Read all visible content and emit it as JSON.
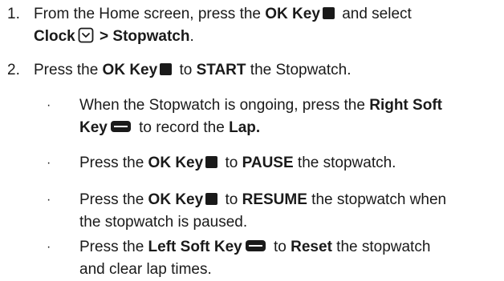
{
  "steps": [
    {
      "number": "1.",
      "line1": {
        "pre": "From the Home screen, press the ",
        "key": "OK Key",
        "post": " and select"
      },
      "line2": {
        "app": "Clock",
        "sep": " > ",
        "target": "Stopwatch",
        "end": "."
      }
    },
    {
      "number": "2.",
      "line1": {
        "pre": "Press the ",
        "key": "OK Key",
        "mid": " to ",
        "action": "START",
        "post": " the Stopwatch."
      }
    }
  ],
  "bullets": [
    {
      "symbol": "·",
      "line1": {
        "pre": "When the Stopwatch is ongoing, press the ",
        "key": "Right Soft"
      },
      "line2": {
        "key": "Key",
        "mid": " to record the ",
        "action": "Lap."
      }
    },
    {
      "symbol": "·",
      "line1": {
        "pre": "Press the ",
        "key": "OK Key",
        "mid": " to ",
        "action": "PAUSE",
        "post": " the stopwatch."
      }
    },
    {
      "symbol": "·",
      "line1": {
        "pre": "Press the ",
        "key": "OK Key",
        "mid": " to ",
        "action": "RESUME",
        "post": " the stopwatch when"
      },
      "line2": {
        "text": "the stopwatch is paused."
      }
    },
    {
      "symbol": "·",
      "line1": {
        "pre": "Press the ",
        "key": "Left Soft Key",
        "mid": " to ",
        "action": "Reset",
        "post": " the stopwatch"
      },
      "line2": {
        "text": "and clear lap times."
      }
    }
  ],
  "icons": {
    "ok_key": "ok-key-icon",
    "soft_key": "soft-key-icon",
    "clock": "clock-icon"
  },
  "colors": {
    "text": "#1a1a1a",
    "background": "#ffffff"
  }
}
